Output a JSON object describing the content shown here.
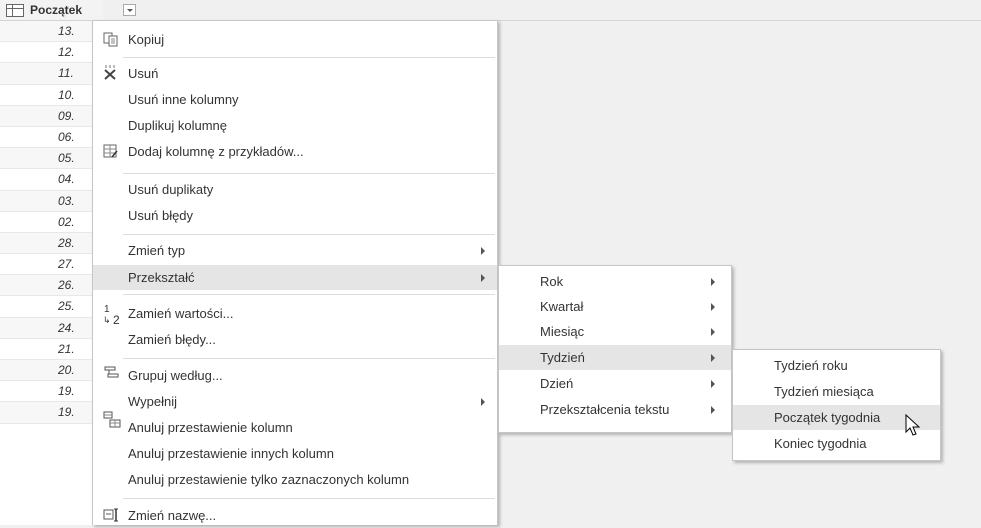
{
  "column": {
    "header": "Początek tyg",
    "values": [
      "13.",
      "12.",
      "11.",
      "10.",
      "09.",
      "06.",
      "05.",
      "04.",
      "03.",
      "02.",
      "28.",
      "27.",
      "26.",
      "25.",
      "24.",
      "21.",
      "20.",
      "19.",
      "19."
    ]
  },
  "context_menu": {
    "items": [
      {
        "label": "Kopiuj"
      },
      {
        "label": "Usuń"
      },
      {
        "label": "Usuń inne kolumny"
      },
      {
        "label": "Duplikuj kolumnę"
      },
      {
        "label": "Dodaj kolumnę z przykładów..."
      },
      {
        "label": "Usuń duplikaty"
      },
      {
        "label": "Usuń błędy"
      },
      {
        "label": "Zmień typ"
      },
      {
        "label": "Przekształć"
      },
      {
        "label": "Zamień wartości..."
      },
      {
        "label": "Zamień błędy..."
      },
      {
        "label": "Grupuj według..."
      },
      {
        "label": "Wypełnij"
      },
      {
        "label": "Anuluj przestawienie kolumn"
      },
      {
        "label": "Anuluj przestawienie innych kolumn"
      },
      {
        "label": "Anuluj przestawienie tylko zaznaczonych kolumn"
      },
      {
        "label": "Zmień nazwę..."
      }
    ]
  },
  "transform_submenu": {
    "items": [
      {
        "label": "Rok"
      },
      {
        "label": "Kwartał"
      },
      {
        "label": "Miesiąc"
      },
      {
        "label": "Tydzień"
      },
      {
        "label": "Dzień"
      },
      {
        "label": "Przekształcenia tekstu"
      }
    ]
  },
  "week_submenu": {
    "items": [
      {
        "label": "Tydzień roku"
      },
      {
        "label": "Tydzień miesiąca"
      },
      {
        "label": "Początek tygodnia"
      },
      {
        "label": "Koniec tygodnia"
      }
    ]
  },
  "replace_icon_text": {
    "top": "1",
    "bottom": "2"
  },
  "colors": {
    "highlight": "#e5e5e5",
    "menu_border": "#c6c6c6",
    "background": "#f0f0f0"
  },
  "icons": [
    "table-icon",
    "dropdown-icon",
    "copy-icon",
    "delete-icon",
    "add-from-examples-icon",
    "replace-values-icon",
    "group-by-icon",
    "unpivot-icon",
    "rename-icon",
    "submenu-arrow-icon",
    "mouse-cursor-icon"
  ]
}
